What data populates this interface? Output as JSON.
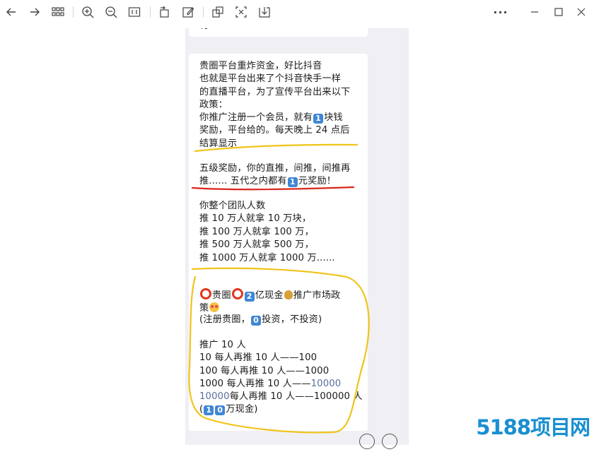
{
  "toolbar": {
    "buttons": [
      {
        "icon": "arrow-left-icon"
      },
      {
        "icon": "arrow-right-icon"
      },
      {
        "icon": "grid-icon"
      },
      {
        "icon": "zoom-in-icon"
      },
      {
        "icon": "zoom-out-icon"
      },
      {
        "icon": "actual-size-icon"
      },
      {
        "icon": "rotate-icon"
      },
      {
        "icon": "edit-icon"
      },
      {
        "icon": "copy-image-icon"
      },
      {
        "icon": "ocr-icon"
      },
      {
        "icon": "save-icon"
      }
    ],
    "window": {
      "more": "···"
    }
  },
  "chat": {
    "top_fragment": "有",
    "p1": "贵圈平台重炸资金，好比抖音\n也就是平台出来了个抖音快手一样\n的直播平台，为了宣传平台出来以下\n政策：",
    "p2_a": "你推广注册一个会员，就有",
    "p2_n": "1",
    "p2_b": "块钱\n奖励，平台给的。每天晚上 24 点后\n结算显示",
    "p3_a": "五级奖励，你的直推，间推，间推再\n推...... 五代之内都有",
    "p3_n": "1",
    "p3_b": "元奖励！",
    "p4": "你整个团队人数\n推 10 万人就拿 10 万块，\n推 100 万人就拿 100 万，\n推 500 万人就拿 500 万，\n推 1000 万人就拿 1000 万......",
    "p5_a": "贵圈",
    "p5_n": "2",
    "p5_b": "亿现金",
    "p5_c": "推广市场政\n策",
    "p6_a": "(注册贵圈，",
    "p6_n": "0",
    "p6_b": "投资，不投资)",
    "p7": "推广 10 人\n10 每人再推 10 人——100\n100 每人再推 10 人——1000",
    "p8_a": "1000 每人再推 10 人——",
    "p8_blue": "10000",
    "p9_blue": "10000",
    "p9_b": "每人再推 10 人——100000 人",
    "p10_a": "(",
    "p10_n1": "1",
    "p10_n2": "0",
    "p10_b": "万现金)"
  },
  "watermark": {
    "text": "5188项目网"
  },
  "colors": {
    "annotation_yellow": "#f0c419",
    "annotation_red": "#d9261c",
    "link_blue": "#5b6f9e"
  }
}
